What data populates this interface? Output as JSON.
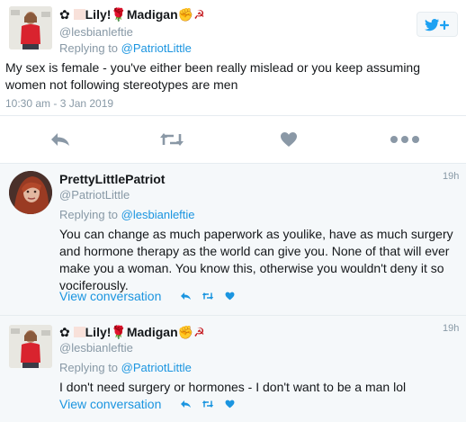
{
  "main_tweet": {
    "display_name_text": "Lily!",
    "display_name_suffix": "Madigan",
    "handle": "@lesbianleftie",
    "replying_prefix": "Replying to",
    "replying_to": "@PatriotLittle",
    "body_line1": "My sex is female - you've either been really mislead or you keep assuming",
    "body_line2": "women not following stereotypes are men",
    "timestamp": "10:30 am - 3 Jan 2019"
  },
  "reply1": {
    "display_name": "PrettyLittlePatriot",
    "handle": "@PatriotLittle",
    "time": "19h",
    "replying_prefix": "Replying to",
    "replying_to": "@lesbianleftie",
    "body_line1": "You can change as much paperwork as youlike, have as much surgery",
    "body_line2": "and hormone therapy as the world can give you. None of that will ever",
    "body_line3": "make you a woman. You know this, otherwise you wouldn't deny it so",
    "body_line4": "vociferously.",
    "view_conversation": "View conversation"
  },
  "reply2": {
    "display_name_text": "Lily!",
    "display_name_suffix": "Madigan",
    "handle": "@lesbianleftie",
    "time": "19h",
    "replying_prefix": "Replying to",
    "replying_to": "@PatriotLittle",
    "body": "I don't need surgery or hormones - I don't want to be a man lol",
    "view_conversation": "View conversation"
  },
  "icons": {
    "reply": "reply-icon",
    "retweet": "retweet-icon",
    "like": "heart-icon",
    "more": "more-dots-icon",
    "follow": "twitter-bird-follow-icon"
  },
  "colors": {
    "accent": "#1b95e0",
    "muted": "#8899a6",
    "icon_gray": "#8a98a6",
    "reply_bg": "#f5f8fa"
  }
}
